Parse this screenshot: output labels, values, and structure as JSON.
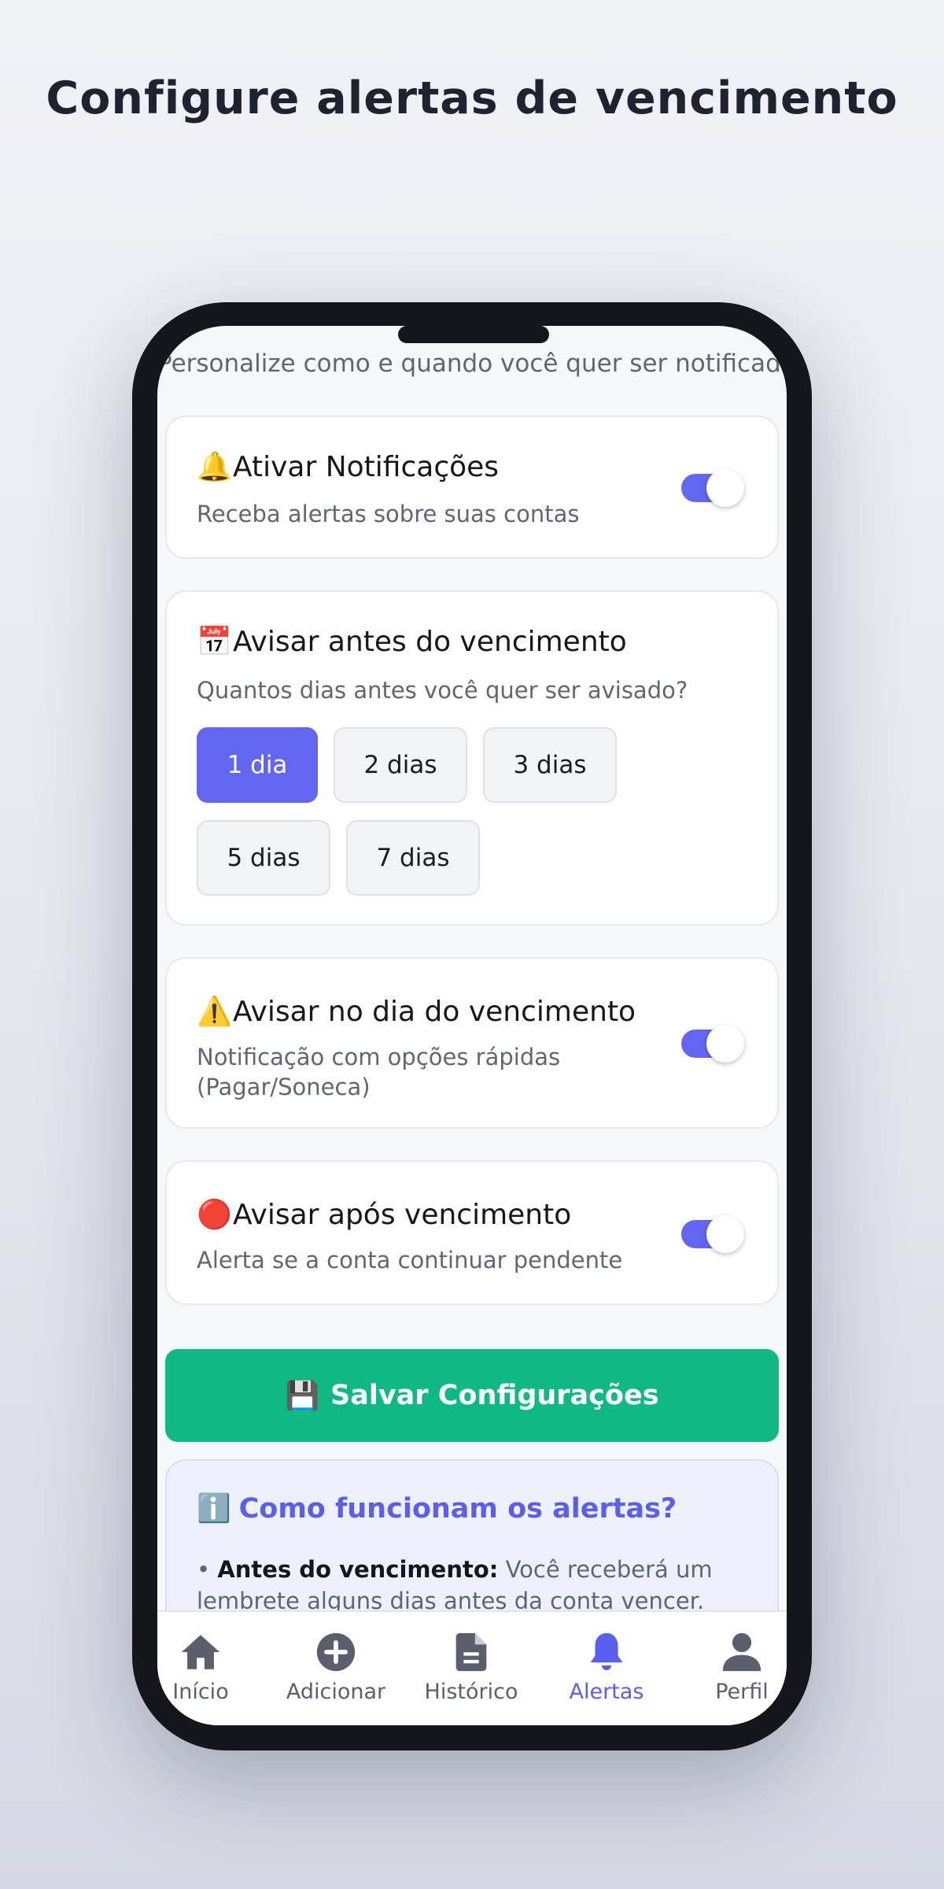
{
  "hero": {
    "title": "Configure alertas de vencimento"
  },
  "screen": {
    "subtitle": "Personalize como e quando você quer ser notificado"
  },
  "notifications": {
    "emoji": "🔔",
    "title": "Ativar Notificações",
    "description": "Receba alertas sobre suas contas",
    "enabled": true
  },
  "before_due": {
    "emoji": "📅",
    "title": "Avisar antes do vencimento",
    "description": "Quantos dias antes você quer ser avisado?",
    "options": [
      "1 dia",
      "2 dias",
      "3 dias",
      "5 dias",
      "7 dias"
    ],
    "selected": "1 dia"
  },
  "on_due": {
    "emoji": "⚠️",
    "title": "Avisar no dia do vencimento",
    "description": "Notificação com opções rápidas (Pagar/Soneca)",
    "enabled": true
  },
  "after_due": {
    "emoji": "🔴",
    "title": "Avisar após vencimento",
    "description": "Alerta se a conta continuar pendente",
    "enabled": true
  },
  "save": {
    "emoji": "💾",
    "label": "Salvar Configurações"
  },
  "info": {
    "emoji": "ℹ️",
    "title": "Como funcionam os alertas?",
    "bullet": "•",
    "item_label": "Antes do vencimento:",
    "item_text": "Você receberá um lembrete alguns dias antes da conta vencer."
  },
  "nav": {
    "items": [
      {
        "label": "Início",
        "icon": "home-icon"
      },
      {
        "label": "Adicionar",
        "icon": "plus-circle-icon"
      },
      {
        "label": "Histórico",
        "icon": "document-icon"
      },
      {
        "label": "Alertas",
        "icon": "bell-icon"
      },
      {
        "label": "Perfil",
        "icon": "user-icon"
      }
    ],
    "active": "Alertas"
  },
  "colors": {
    "accent": "#6366f1",
    "save": "#10b981",
    "info_bg": "#eef1fb"
  }
}
